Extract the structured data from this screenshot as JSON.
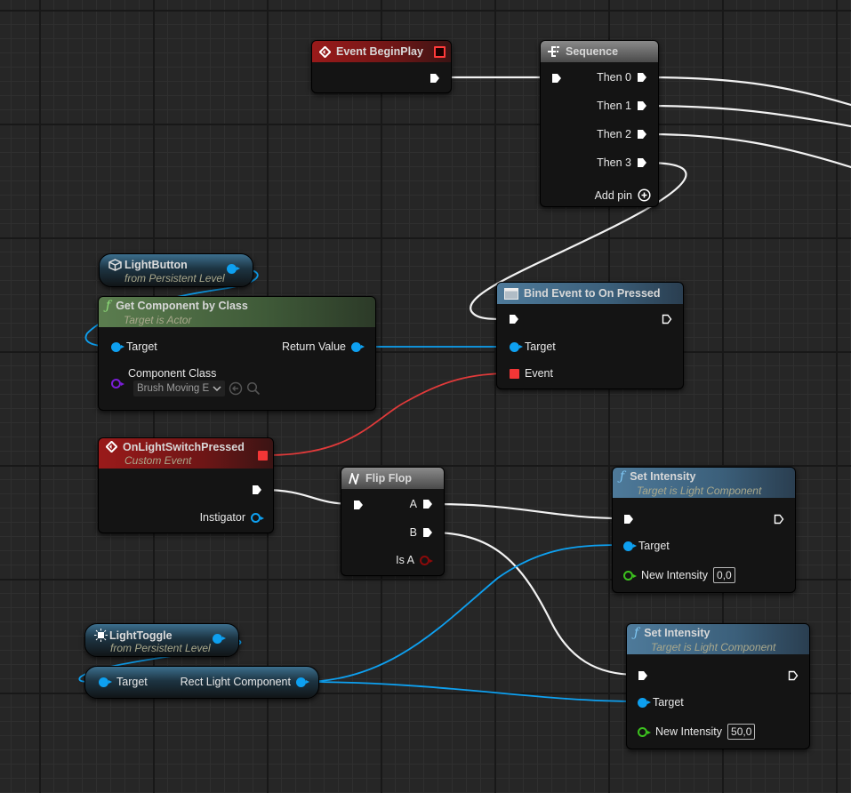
{
  "canvas": {
    "wire_colors": {
      "exec": "#ffffff",
      "object": "#0ea0f0",
      "delegate": "#e03a3a"
    }
  },
  "nodes": {
    "begin_play": {
      "title": "Event BeginPlay",
      "icon": "event-diamond-icon"
    },
    "sequence": {
      "title": "Sequence",
      "icon": "sequence-icon",
      "outputs": [
        "Then 0",
        "Then 1",
        "Then 2",
        "Then 3"
      ],
      "add_pin": "Add pin"
    },
    "light_button": {
      "title": "LightButton",
      "subtitle": "from Persistent Level",
      "icon": "actor-cube-icon"
    },
    "get_component": {
      "title": "Get Component by Class",
      "subtitle": "Target is Actor",
      "icon": "function-icon",
      "target": "Target",
      "return_value": "Return Value",
      "component_class": "Component Class",
      "class_value": "Brush Moving E"
    },
    "bind_event": {
      "title": "Bind Event to On Pressed",
      "icon": "delegate-icon",
      "target": "Target",
      "event": "Event"
    },
    "custom_event": {
      "title": "OnLightSwitchPressed",
      "subtitle": "Custom Event",
      "icon": "event-diamond-icon",
      "instigator": "Instigator"
    },
    "flip_flop": {
      "title": "Flip Flop",
      "icon": "flipflop-icon",
      "a": "A",
      "b": "B",
      "is_a": "Is A"
    },
    "set_intensity_1": {
      "title": "Set Intensity",
      "subtitle": "Target is Light Component",
      "icon": "function-icon",
      "target": "Target",
      "new_intensity": "New Intensity",
      "value": "0,0"
    },
    "set_intensity_2": {
      "title": "Set Intensity",
      "subtitle": "Target is Light Component",
      "icon": "function-icon",
      "target": "Target",
      "new_intensity": "New Intensity",
      "value": "50,0"
    },
    "light_toggle": {
      "title": "LightToggle",
      "subtitle": "from Persistent Level",
      "icon": "light-icon"
    },
    "rect_light": {
      "target": "Target",
      "output": "Rect Light Component"
    }
  }
}
